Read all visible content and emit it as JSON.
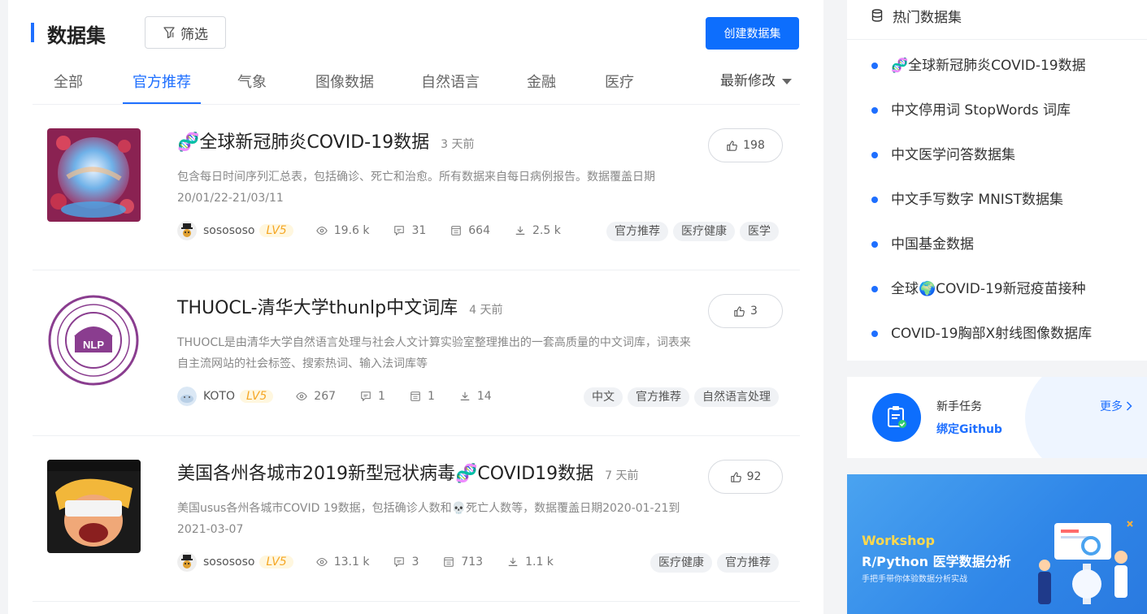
{
  "header": {
    "title": "数据集",
    "filter_label": "筛选",
    "create_label": "创建数据集"
  },
  "tabs": [
    {
      "label": "全部"
    },
    {
      "label": "官方推荐"
    },
    {
      "label": "气象"
    },
    {
      "label": "图像数据"
    },
    {
      "label": "自然语言"
    },
    {
      "label": "金融"
    },
    {
      "label": "医疗"
    }
  ],
  "active_tab": "官方推荐",
  "sort_label": "最新修改",
  "datasets": [
    {
      "title": "🧬全球新冠肺炎COVID-19数据",
      "time": "3 天前",
      "likes": "198",
      "desc": "包含每日时间序列汇总表，包括确诊、死亡和治愈。所有数据来自每日病例报告。数据覆盖日期 20/01/22-21/03/11",
      "user": "sosososo",
      "level": "LV5",
      "views": "19.6 k",
      "comments": "31",
      "files": "664",
      "downloads": "2.5 k",
      "tags": [
        "官方推荐",
        "医疗健康",
        "医学"
      ]
    },
    {
      "title": "THUOCL-清华大学thunlp中文词库",
      "time": "4 天前",
      "likes": "3",
      "desc": "THUOCL是由清华大学自然语言处理与社会人文计算实验室整理推出的一套高质量的中文词库，词表来自主流网站的社会标签、搜索热词、输入法词库等",
      "user": "KOTO",
      "level": "LV5",
      "views": "267",
      "comments": "1",
      "files": "1",
      "downloads": "14",
      "tags": [
        "中文",
        "官方推荐",
        "自然语言处理"
      ]
    },
    {
      "title": "美国各州各城市2019新型冠状病毒🧬COVID19数据",
      "time": "7 天前",
      "likes": "92",
      "desc": "美国usus各州各城市COVID 19数据，包括确诊人数和💀死亡人数等，数据覆盖日期2020-01-21到2021-03-07",
      "user": "sosososo",
      "level": "LV5",
      "views": "13.1 k",
      "comments": "3",
      "files": "713",
      "downloads": "1.1 k",
      "tags": [
        "医疗健康",
        "官方推荐"
      ]
    }
  ],
  "hot": {
    "title": "热门数据集",
    "items": [
      "🧬全球新冠肺炎COVID-19数据",
      "中文停用词 StopWords 词库",
      "中文医学问答数据集",
      "中文手写数字 MNIST数据集",
      "中国基金数据",
      "全球🌍COVID-19新冠疫苗接种",
      "COVID-19胸部X射线图像数据库"
    ]
  },
  "task": {
    "title": "新手任务",
    "link": "绑定Github",
    "more": "更多"
  },
  "banner": {
    "workshop": "Workshop",
    "title": "R/Python 医学数据分析",
    "subtitle": "手把手带你体验数据分析实战"
  },
  "colors": {
    "accent": "#1e6fff",
    "button": "#0d6efd",
    "level": "#f5a623"
  }
}
